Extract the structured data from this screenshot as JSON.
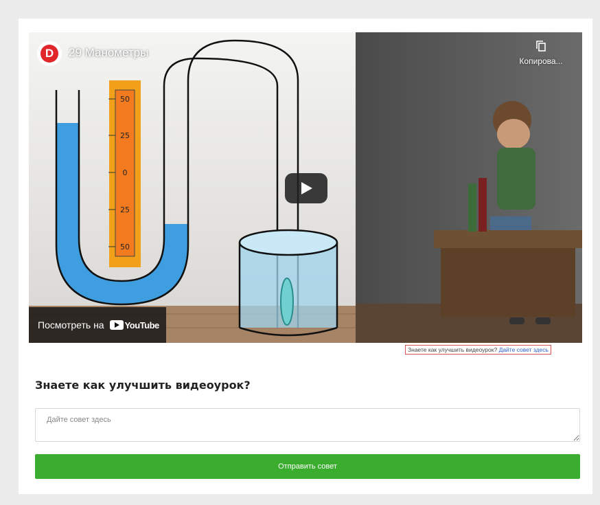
{
  "video": {
    "channel_logo_letter": "D",
    "title": "29 Манометры",
    "copy_label": "Копирова...",
    "watch_on_label": "Посмотреть на",
    "youtube_label": "YouTube",
    "scale_ticks": [
      "50",
      "25",
      "0",
      "25",
      "50"
    ],
    "colors": {
      "liquid": "#3f9ee0",
      "scale": "#f47a1f",
      "scale_frame": "#f2a01a",
      "play": "#ffffff"
    }
  },
  "hint": {
    "text": "Знаете как улучшить видеоурок?",
    "link": "Дайте совет здесь"
  },
  "form": {
    "heading": "Знаете как улучшить видеоурок?",
    "placeholder": "Дайте совет здесь",
    "submit_label": "Отправить совет",
    "submit_color": "#3aad2e"
  }
}
